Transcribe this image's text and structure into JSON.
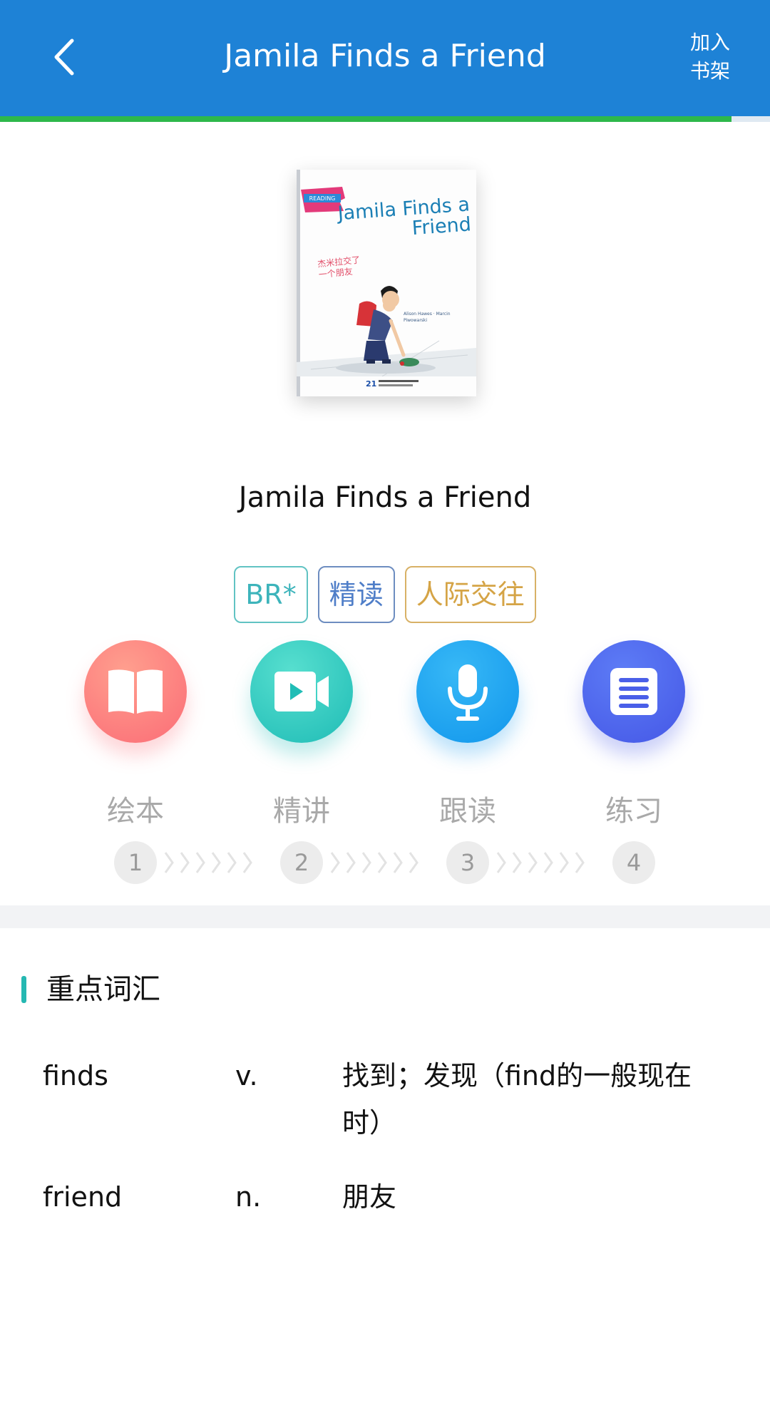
{
  "header": {
    "title": "Jamila Finds a Friend",
    "shelf_label_line1": "加入",
    "shelf_label_line2": "书架",
    "progress": 0.95
  },
  "cover": {
    "badge_text": "READING",
    "title": "Jamila Finds a Friend",
    "subtitle": "杰米拉交了一个朋友",
    "credits": "Alison Hawes · Marcin Piwowarski"
  },
  "book": {
    "title": "Jamila Finds a Friend"
  },
  "tags": [
    "BR*",
    "精读",
    "人际交往"
  ],
  "steps": [
    {
      "label": "绘本",
      "number": "1",
      "icon": "book-icon"
    },
    {
      "label": "精讲",
      "number": "2",
      "icon": "video-icon"
    },
    {
      "label": "跟读",
      "number": "3",
      "icon": "microphone-icon"
    },
    {
      "label": "练习",
      "number": "4",
      "icon": "document-icon"
    }
  ],
  "vocab": {
    "title": "重点词汇",
    "items": [
      {
        "word": "finds",
        "pos": "v.",
        "meaning": "找到；发现（find的一般现在时）"
      },
      {
        "word": "friend",
        "pos": "n.",
        "meaning": "朋友"
      }
    ]
  },
  "colors": {
    "header_bg": "#1e82d6",
    "progress": "#2db84b",
    "accent_teal": "#25b8b2"
  }
}
